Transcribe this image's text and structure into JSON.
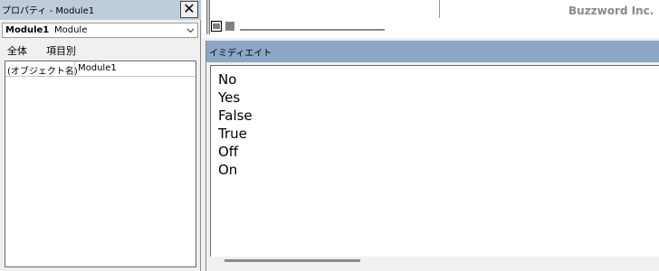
{
  "properties": {
    "title": "プロパティ - Module1",
    "close_label": "✕",
    "object_name": "Module1",
    "object_type": "Module",
    "tabs": [
      "全体",
      "項目別"
    ],
    "rows": [
      {
        "name": "(オブジェクト名)",
        "value": "Module1"
      }
    ]
  },
  "toolbar": {
    "watermark": "Buzzword Inc."
  },
  "immediate": {
    "title": "イミディエイト",
    "lines": [
      "No",
      "Yes",
      "False",
      "True",
      "Off",
      "On"
    ]
  }
}
